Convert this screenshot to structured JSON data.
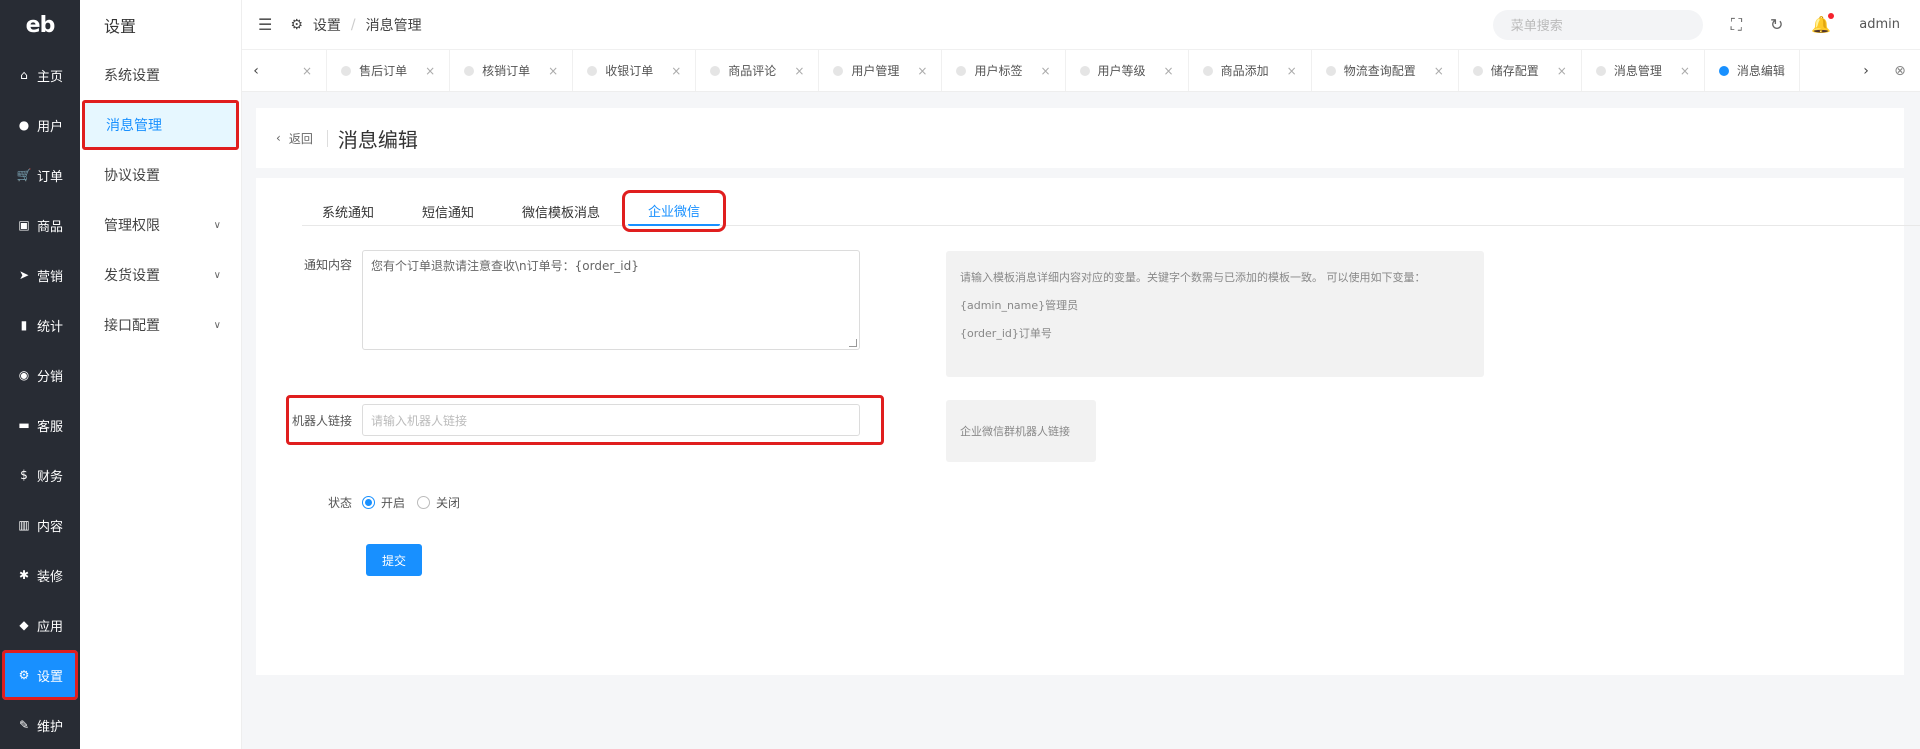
{
  "logo": {
    "text_e": "e",
    "text_b": "b"
  },
  "main_nav": [
    {
      "label": "主页",
      "icon": "⌂",
      "icon_name": "home-icon"
    },
    {
      "label": "用户",
      "icon": "●",
      "icon_name": "user-icon"
    },
    {
      "label": "订单",
      "icon": "🛒",
      "icon_name": "cart-icon"
    },
    {
      "label": "商品",
      "icon": "▣",
      "icon_name": "goods-icon"
    },
    {
      "label": "营销",
      "icon": "➤",
      "icon_name": "marketing-icon"
    },
    {
      "label": "统计",
      "icon": "▮",
      "icon_name": "stats-icon"
    },
    {
      "label": "分销",
      "icon": "◉",
      "icon_name": "distribution-icon"
    },
    {
      "label": "客服",
      "icon": "▬",
      "icon_name": "service-icon"
    },
    {
      "label": "财务",
      "icon": "$",
      "icon_name": "finance-icon"
    },
    {
      "label": "内容",
      "icon": "▥",
      "icon_name": "content-icon"
    },
    {
      "label": "装修",
      "icon": "✱",
      "icon_name": "decorate-icon"
    },
    {
      "label": "应用",
      "icon": "◆",
      "icon_name": "app-icon"
    },
    {
      "label": "设置",
      "icon": "⚙",
      "icon_name": "gear-icon"
    },
    {
      "label": "维护",
      "icon": "✎",
      "icon_name": "maintain-icon"
    }
  ],
  "sub_nav": {
    "title": "设置",
    "items": [
      {
        "label": "系统设置",
        "has_arrow": false
      },
      {
        "label": "消息管理",
        "has_arrow": false
      },
      {
        "label": "协议设置",
        "has_arrow": false
      },
      {
        "label": "管理权限",
        "has_arrow": true
      },
      {
        "label": "发货设置",
        "has_arrow": true
      },
      {
        "label": "接口配置",
        "has_arrow": true
      }
    ]
  },
  "header": {
    "breadcrumb_root": "设置",
    "breadcrumb_sep": "/",
    "breadcrumb_current": "消息管理",
    "search_placeholder": "菜单搜索",
    "user": "admin"
  },
  "tabs": [
    {
      "label": ""
    },
    {
      "label": "售后订单"
    },
    {
      "label": "核销订单"
    },
    {
      "label": "收银订单"
    },
    {
      "label": "商品评论"
    },
    {
      "label": "用户管理"
    },
    {
      "label": "用户标签"
    },
    {
      "label": "用户等级"
    },
    {
      "label": "商品添加"
    },
    {
      "label": "物流查询配置"
    },
    {
      "label": "储存配置"
    },
    {
      "label": "消息管理"
    },
    {
      "label": "消息编辑"
    }
  ],
  "page": {
    "back_label": "返回",
    "title": "消息编辑"
  },
  "content_tabs": [
    "系统通知",
    "短信通知",
    "微信模板消息",
    "企业微信"
  ],
  "form": {
    "content_label": "通知内容",
    "content_value": "您有个订单退款请注意查收\\n订单号：{order_id}",
    "robot_label": "机器人链接",
    "robot_placeholder": "请输入机器人链接",
    "status_label": "状态",
    "status_on": "开启",
    "status_off": "关闭",
    "submit": "提交"
  },
  "hints": {
    "content_hint_1": "请输入模板消息详细内容对应的变量。关键字个数需与已添加的模板一致。 可以使用如下变量：",
    "content_hint_2": "{admin_name}管理员",
    "content_hint_3": "{order_id}订单号",
    "robot_hint": "企业微信群机器人链接"
  },
  "colors": {
    "accent": "#1890ff",
    "sidebar": "#282c34",
    "highlight": "#e01e1e"
  }
}
